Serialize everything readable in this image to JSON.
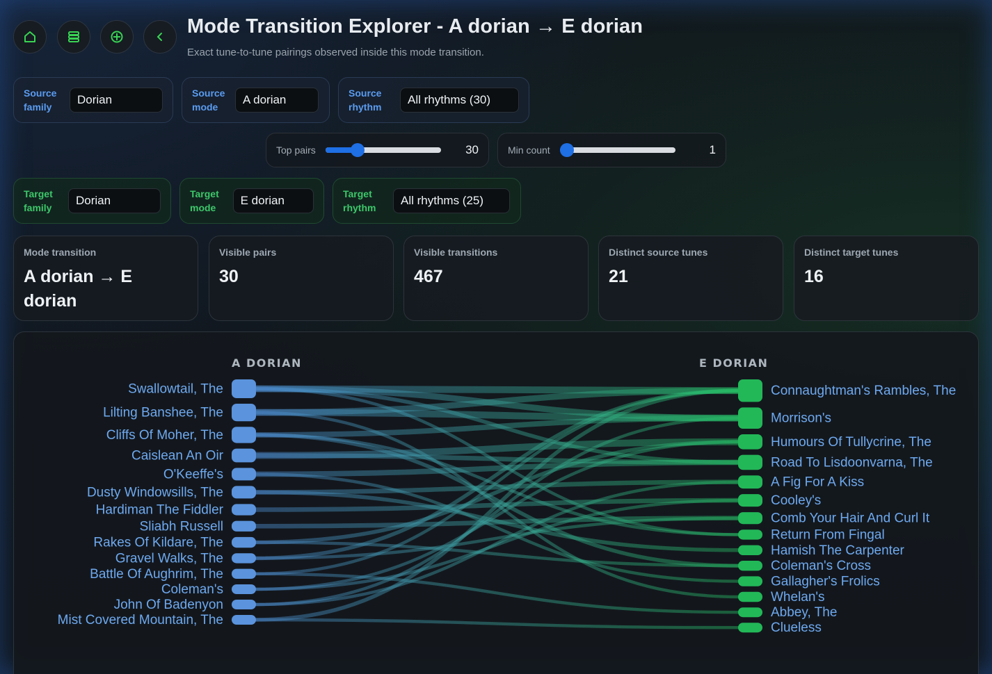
{
  "header": {
    "title": "Mode Transition Explorer - A dorian → E dorian",
    "subtitle": "Exact tune-to-tune pairings observed inside this mode transition."
  },
  "nav": [
    {
      "icon": "home-icon"
    },
    {
      "icon": "database-icon"
    },
    {
      "icon": "crosshair-icon"
    },
    {
      "icon": "chevron-left-icon"
    }
  ],
  "source_filters": {
    "family": {
      "label": "Source family",
      "value": "Dorian"
    },
    "mode": {
      "label": "Source mode",
      "value": "A dorian"
    },
    "rhythm": {
      "label": "Source rhythm",
      "value": "All rhythms (30)"
    }
  },
  "sliders": {
    "top_pairs": {
      "label": "Top pairs",
      "value": "30",
      "fraction": 0.25
    },
    "min_count": {
      "label": "Min count",
      "value": "1",
      "fraction": 0.0
    }
  },
  "target_filters": {
    "family": {
      "label": "Target family",
      "value": "Dorian"
    },
    "mode": {
      "label": "Target mode",
      "value": "E dorian"
    },
    "rhythm": {
      "label": "Target rhythm",
      "value": "All rhythms (25)"
    }
  },
  "stats": [
    {
      "label": "Mode transition",
      "value": "A dorian → E dorian"
    },
    {
      "label": "Visible pairs",
      "value": "30"
    },
    {
      "label": "Visible transitions",
      "value": "467"
    },
    {
      "label": "Distinct source tunes",
      "value": "21"
    },
    {
      "label": "Distinct target tunes",
      "value": "16"
    }
  ],
  "colors": {
    "source": "#5b93dc",
    "target": "#22b858",
    "accent": "#1f6fe5"
  },
  "chart_data": {
    "type": "sankey",
    "source_title": "A DORIAN",
    "target_title": "E DORIAN",
    "sources": [
      {
        "name": "Swallowtail, The",
        "weight": 30
      },
      {
        "name": "Lilting Banshee, The",
        "weight": 28
      },
      {
        "name": "Cliffs Of Moher, The",
        "weight": 26
      },
      {
        "name": "Caislean An Oir",
        "weight": 22
      },
      {
        "name": "O'Keeffe's",
        "weight": 20
      },
      {
        "name": "Dusty Windowsills, The",
        "weight": 20
      },
      {
        "name": "Hardiman The Fiddler",
        "weight": 18
      },
      {
        "name": "Sliabh Russell",
        "weight": 17
      },
      {
        "name": "Rakes Of Kildare, The",
        "weight": 17
      },
      {
        "name": "Gravel Walks, The",
        "weight": 16
      },
      {
        "name": "Battle Of Aughrim, The",
        "weight": 16
      },
      {
        "name": "Coleman's",
        "weight": 15
      },
      {
        "name": "John Of Badenyon",
        "weight": 15
      },
      {
        "name": "Mist Covered Mountain, The",
        "weight": 15
      }
    ],
    "targets": [
      {
        "name": "Connaughtman's Rambles, The",
        "weight": 36
      },
      {
        "name": "Morrison's",
        "weight": 34
      },
      {
        "name": "Humours Of Tullycrine, The",
        "weight": 24
      },
      {
        "name": "Road To Lisdoonvarna, The",
        "weight": 24
      },
      {
        "name": "A Fig For A Kiss",
        "weight": 21
      },
      {
        "name": "Cooley's",
        "weight": 20
      },
      {
        "name": "Comb Your Hair And Curl It",
        "weight": 19
      },
      {
        "name": "Return From Fingal",
        "weight": 16
      },
      {
        "name": "Hamish The Carpenter",
        "weight": 16
      },
      {
        "name": "Coleman's Cross",
        "weight": 16
      },
      {
        "name": "Gallagher's Frolics",
        "weight": 16
      },
      {
        "name": "Whelan's",
        "weight": 16
      },
      {
        "name": "Abbey, The",
        "weight": 15
      },
      {
        "name": "Clueless",
        "weight": 15
      }
    ],
    "links": [
      {
        "source": "Swallowtail, The",
        "target": "Connaughtman's Rambles, The",
        "value": 9
      },
      {
        "source": "Swallowtail, The",
        "target": "Morrison's",
        "value": 8
      },
      {
        "source": "Swallowtail, The",
        "target": "Road To Lisdoonvarna, The",
        "value": 5
      },
      {
        "source": "Swallowtail, The",
        "target": "Return From Fingal",
        "value": 4
      },
      {
        "source": "Lilting Banshee, The",
        "target": "Connaughtman's Rambles, The",
        "value": 8
      },
      {
        "source": "Lilting Banshee, The",
        "target": "Morrison's",
        "value": 9
      },
      {
        "source": "Lilting Banshee, The",
        "target": "Whelan's",
        "value": 4
      },
      {
        "source": "Cliffs Of Moher, The",
        "target": "Morrison's",
        "value": 7
      },
      {
        "source": "Cliffs Of Moher, The",
        "target": "Coleman's Cross",
        "value": 5
      },
      {
        "source": "Caislean An Oir",
        "target": "Humours Of Tullycrine, The",
        "value": 9
      },
      {
        "source": "Caislean An Oir",
        "target": "Road To Lisdoonvarna, The",
        "value": 6
      },
      {
        "source": "O'Keeffe's",
        "target": "Road To Lisdoonvarna, The",
        "value": 7
      },
      {
        "source": "O'Keeffe's",
        "target": "Gallagher's Frolics",
        "value": 4
      },
      {
        "source": "Dusty Windowsills, The",
        "target": "A Fig For A Kiss",
        "value": 6
      },
      {
        "source": "Dusty Windowsills, The",
        "target": "Hamish The Carpenter",
        "value": 5
      },
      {
        "source": "Hardiman The Fiddler",
        "target": "Cooley's",
        "value": 6
      },
      {
        "source": "Sliabh Russell",
        "target": "Comb Your Hair And Curl It",
        "value": 6
      },
      {
        "source": "Rakes Of Kildare, The",
        "target": "Humours Of Tullycrine, The",
        "value": 5
      },
      {
        "source": "Gravel Walks, The",
        "target": "Connaughtman's Rambles, The",
        "value": 5
      },
      {
        "source": "Battle Of Aughrim, The",
        "target": "Abbey, The",
        "value": 4
      },
      {
        "source": "Coleman's",
        "target": "Cooley's",
        "value": 4
      },
      {
        "source": "John Of Badenyon",
        "target": "A Fig For A Kiss",
        "value": 4
      },
      {
        "source": "Mist Covered Mountain, The",
        "target": "Connaughtman's Rambles, The",
        "value": 5
      },
      {
        "source": "Mist Covered Mountain, The",
        "target": "Clueless",
        "value": 4
      },
      {
        "source": "Gravel Walks, The",
        "target": "Comb Your Hair And Curl It",
        "value": 4
      },
      {
        "source": "John Of Badenyon",
        "target": "Morrison's",
        "value": 4
      },
      {
        "source": "Battle Of Aughrim, The",
        "target": "Connaughtman's Rambles, The",
        "value": 4
      },
      {
        "source": "Coleman's",
        "target": "Humours Of Tullycrine, The",
        "value": 4
      },
      {
        "source": "Rakes Of Kildare, The",
        "target": "Coleman's Cross",
        "value": 4
      },
      {
        "source": "Cliffs Of Moher, The",
        "target": "Return From Fingal",
        "value": 4
      }
    ]
  }
}
